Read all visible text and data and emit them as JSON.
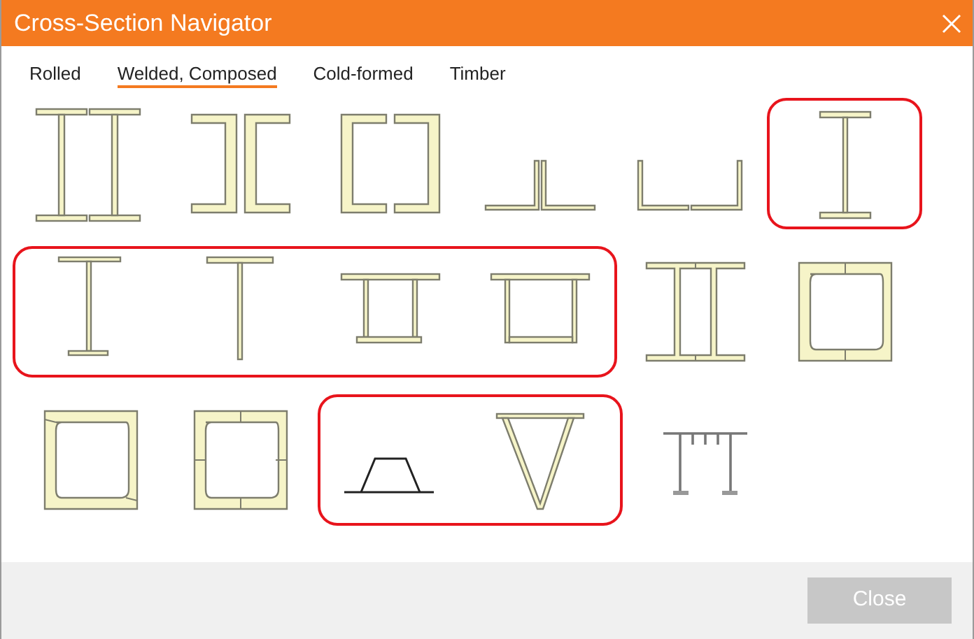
{
  "window": {
    "title": "Cross-Section Navigator"
  },
  "tabs": [
    {
      "label": "Rolled",
      "selected": false
    },
    {
      "label": "Welded, Composed",
      "selected": true
    },
    {
      "label": "Cold-formed",
      "selected": false
    },
    {
      "label": "Timber",
      "selected": false
    }
  ],
  "rows": [
    {
      "groups": [
        {
          "highlighted": false,
          "items": [
            {
              "kind": "double-i"
            },
            {
              "kind": "channels-back"
            },
            {
              "kind": "channels-face"
            },
            {
              "kind": "angles-back"
            },
            {
              "kind": "angles-apart"
            }
          ]
        },
        {
          "highlighted": true,
          "items": [
            {
              "kind": "welded-i"
            }
          ]
        }
      ]
    },
    {
      "groups": [
        {
          "highlighted": true,
          "items": [
            {
              "kind": "welded-i-unequal"
            },
            {
              "kind": "welded-t"
            },
            {
              "kind": "box-plate"
            },
            {
              "kind": "box-inset"
            }
          ]
        },
        {
          "highlighted": false,
          "items": [
            {
              "kind": "double-i-joined"
            },
            {
              "kind": "box-channels"
            }
          ]
        }
      ]
    },
    {
      "groups": [
        {
          "highlighted": false,
          "items": [
            {
              "kind": "box-angles"
            },
            {
              "kind": "box-four"
            }
          ]
        },
        {
          "highlighted": true,
          "items": [
            {
              "kind": "trapezoid"
            },
            {
              "kind": "triangle"
            }
          ]
        },
        {
          "highlighted": false,
          "items": [
            {
              "kind": "multi-web"
            }
          ]
        }
      ]
    }
  ],
  "footer": {
    "close_button": "Close"
  }
}
